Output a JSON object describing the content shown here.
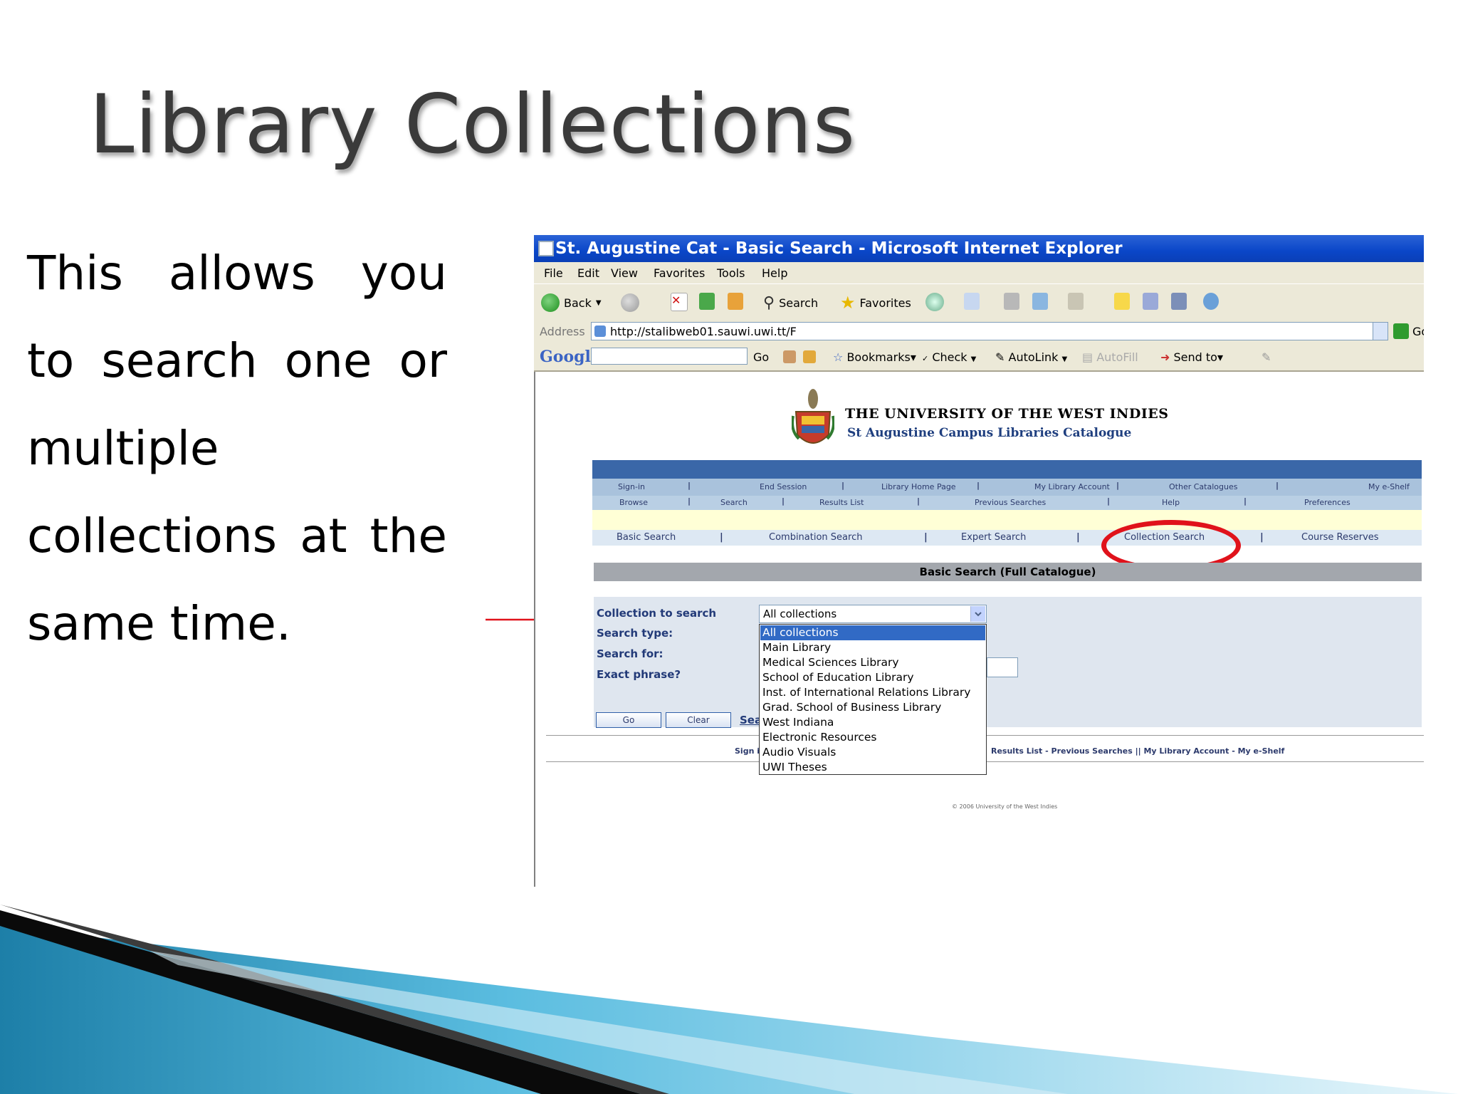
{
  "slide": {
    "title": "Library Collections",
    "body_lines": [
      "This allows you",
      "to search one or",
      "multiple",
      "collections at the",
      "same time."
    ]
  },
  "browser": {
    "title": "St. Augustine Cat - Basic Search - Microsoft Internet Explorer",
    "menu": [
      "File",
      "Edit",
      "View",
      "Favorites",
      "Tools",
      "Help"
    ],
    "toolbar": {
      "back": "Back",
      "search": "Search",
      "favorites": "Favorites"
    },
    "address": {
      "label": "Address",
      "url": "http://stalibweb01.sauwi.uwi.tt/F",
      "go": "Go"
    },
    "google_bar": {
      "logo": "Google",
      "go": "Go",
      "bookmarks": "Bookmarks▾",
      "check": "Check",
      "autolink": "AutoLink",
      "autofill": "AutoFill",
      "send_to": "Send to▾"
    }
  },
  "page": {
    "university": "THE UNIVERSITY OF THE WEST INDIES",
    "catalogue": "St Augustine Campus Libraries Catalogue",
    "nav_row1": [
      "Sign-in",
      "End Session",
      "Library Home Page",
      "My Library Account",
      "Other Catalogues",
      "My e-Shelf"
    ],
    "nav_row2": [
      "Browse",
      "Search",
      "Results List",
      "Previous Searches",
      "Help",
      "Preferences"
    ],
    "nav_row3": [
      "Basic Search",
      "Combination Search",
      "Expert Search",
      "Collection Search",
      "Course Reserves"
    ],
    "section_header": "Basic Search (Full Catalogue)",
    "form": {
      "collection_label": "Collection to search",
      "search_type_label": "Search type:",
      "search_for_label": "Search for:",
      "exact_label": "Exact phrase?",
      "selected_collection": "All collections",
      "go_button": "Go",
      "clear_button": "Clear",
      "search_link": "Sea"
    },
    "collection_options": [
      "All collections",
      "Main Library",
      "Medical Sciences Library",
      "School of Education Library",
      "Inst. of International Relations Library",
      "Grad. School of Business Library",
      "West Indiana",
      "Electronic Resources",
      "Audio Visuals",
      "UWI Theses"
    ],
    "footer_signin": "Sign i",
    "footer_links": "Results List - Previous Searches  ||  My Library Account - My e-Shelf",
    "copyright": "© 2006 University of the West Indies"
  },
  "colors": {
    "highlight_ellipse": "#e0121b",
    "titlebar": "#0a46c8",
    "nav_blue": "#3a67a8"
  }
}
